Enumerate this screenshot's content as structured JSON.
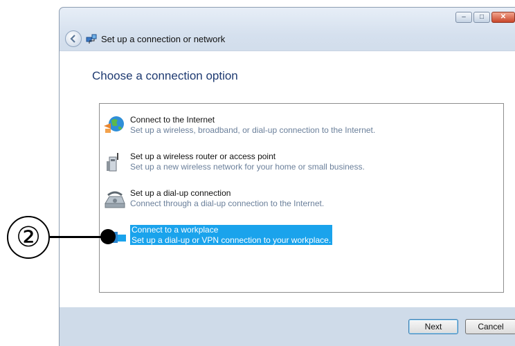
{
  "window": {
    "title": "Set up a connection or network",
    "controls": {
      "minimize": "–",
      "maximize": "□",
      "close": "✕"
    }
  },
  "main": {
    "heading": "Choose a connection option",
    "options": [
      {
        "label": "Connect to the Internet",
        "description": "Set up a wireless, broadband, or dial-up connection to the Internet.",
        "icon": "globe-icon",
        "selected": false
      },
      {
        "label": "Set up a wireless router or access point",
        "description": "Set up a new wireless network for your home or small business.",
        "icon": "router-icon",
        "selected": false
      },
      {
        "label": "Set up a dial-up connection",
        "description": "Connect through a dial-up connection to the Internet.",
        "icon": "phone-icon",
        "selected": false
      },
      {
        "label": "Connect to a workplace",
        "description": "Set up a dial-up or VPN connection to your workplace.",
        "icon": "workplace-icon",
        "selected": true
      }
    ]
  },
  "buttons": {
    "next": "Next",
    "cancel": "Cancel"
  },
  "annotation": {
    "marker": "②"
  },
  "colors": {
    "selection": "#1aa3ec",
    "heading": "#1e3a71",
    "description": "#6a7f9a"
  }
}
